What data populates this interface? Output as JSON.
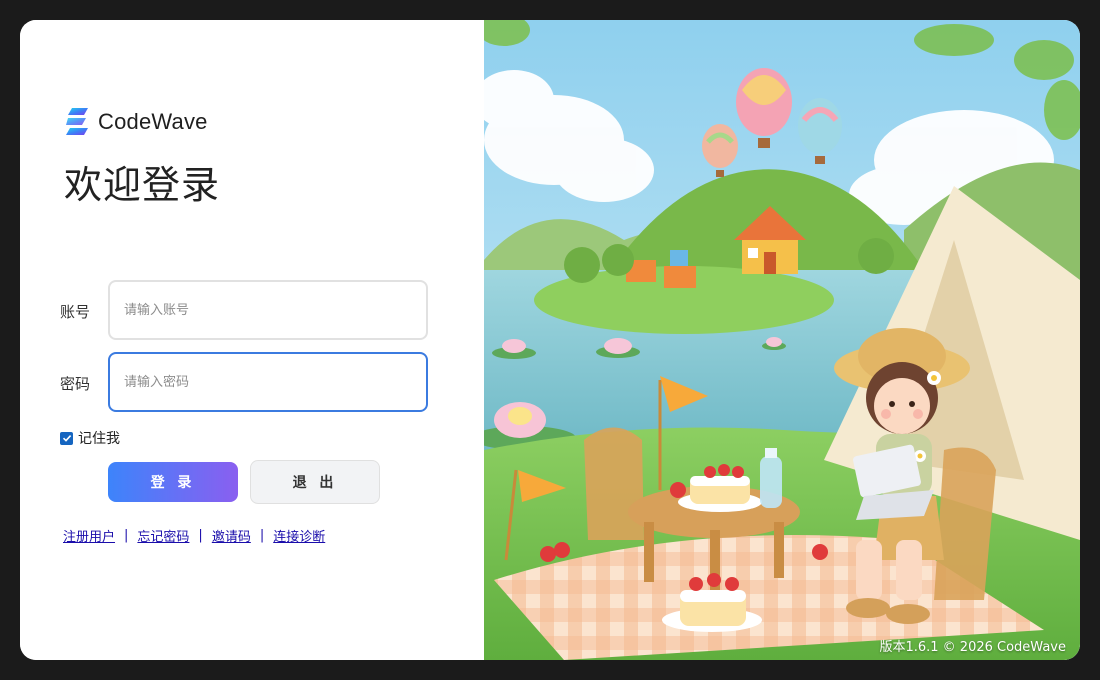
{
  "brand": {
    "name": "CodeWave"
  },
  "login": {
    "title": "欢迎登录",
    "account_label": "账号",
    "account_placeholder": "请输入账号",
    "password_label": "密码",
    "password_placeholder": "请输入密码",
    "remember_label": "记住我",
    "remember_checked": true,
    "login_button": "登 录",
    "exit_button": "退 出"
  },
  "links": [
    {
      "label": "注册用户"
    },
    {
      "label": "忘记密码"
    },
    {
      "label": "邀请码"
    },
    {
      "label": "连接诊断"
    }
  ],
  "link_separator": "|",
  "footer": {
    "version": "版本1.6.1 © 2026 CodeWave"
  },
  "colors": {
    "accent": "#3b7be0",
    "login_gradient_start": "#3d84fb",
    "login_gradient_end": "#8a5ff0",
    "checkbox": "#1565c0"
  },
  "icons": {
    "logo": "codewave-logo-icon",
    "checkbox": "checkmark-icon"
  },
  "illustration": {
    "subject": "picnic-scene-illustration"
  }
}
